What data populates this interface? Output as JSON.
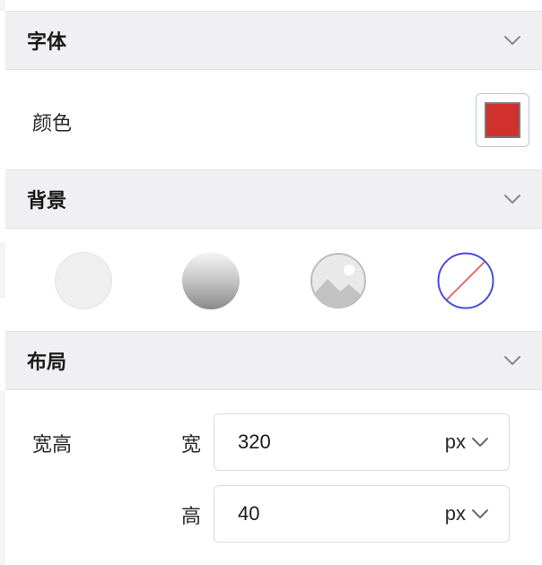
{
  "colors": {
    "header_bg": "#f0f0f2",
    "text_color_swatch": "#d0312d",
    "none_ring": "#4a4ae0",
    "none_slash": "#e05555"
  },
  "font_section": {
    "title": "字体",
    "expanded_icon": "chevron-down-icon",
    "color_label": "颜色"
  },
  "background_section": {
    "title": "背景",
    "expanded_icon": "chevron-down-icon",
    "options": [
      "solid",
      "gradient",
      "image",
      "none"
    ]
  },
  "layout_section": {
    "title": "布局",
    "expanded_icon": "chevron-down-icon",
    "size_label": "宽高",
    "width": {
      "label": "宽",
      "value": "320",
      "unit": "px"
    },
    "height": {
      "label": "高",
      "value": "40",
      "unit": "px"
    }
  }
}
